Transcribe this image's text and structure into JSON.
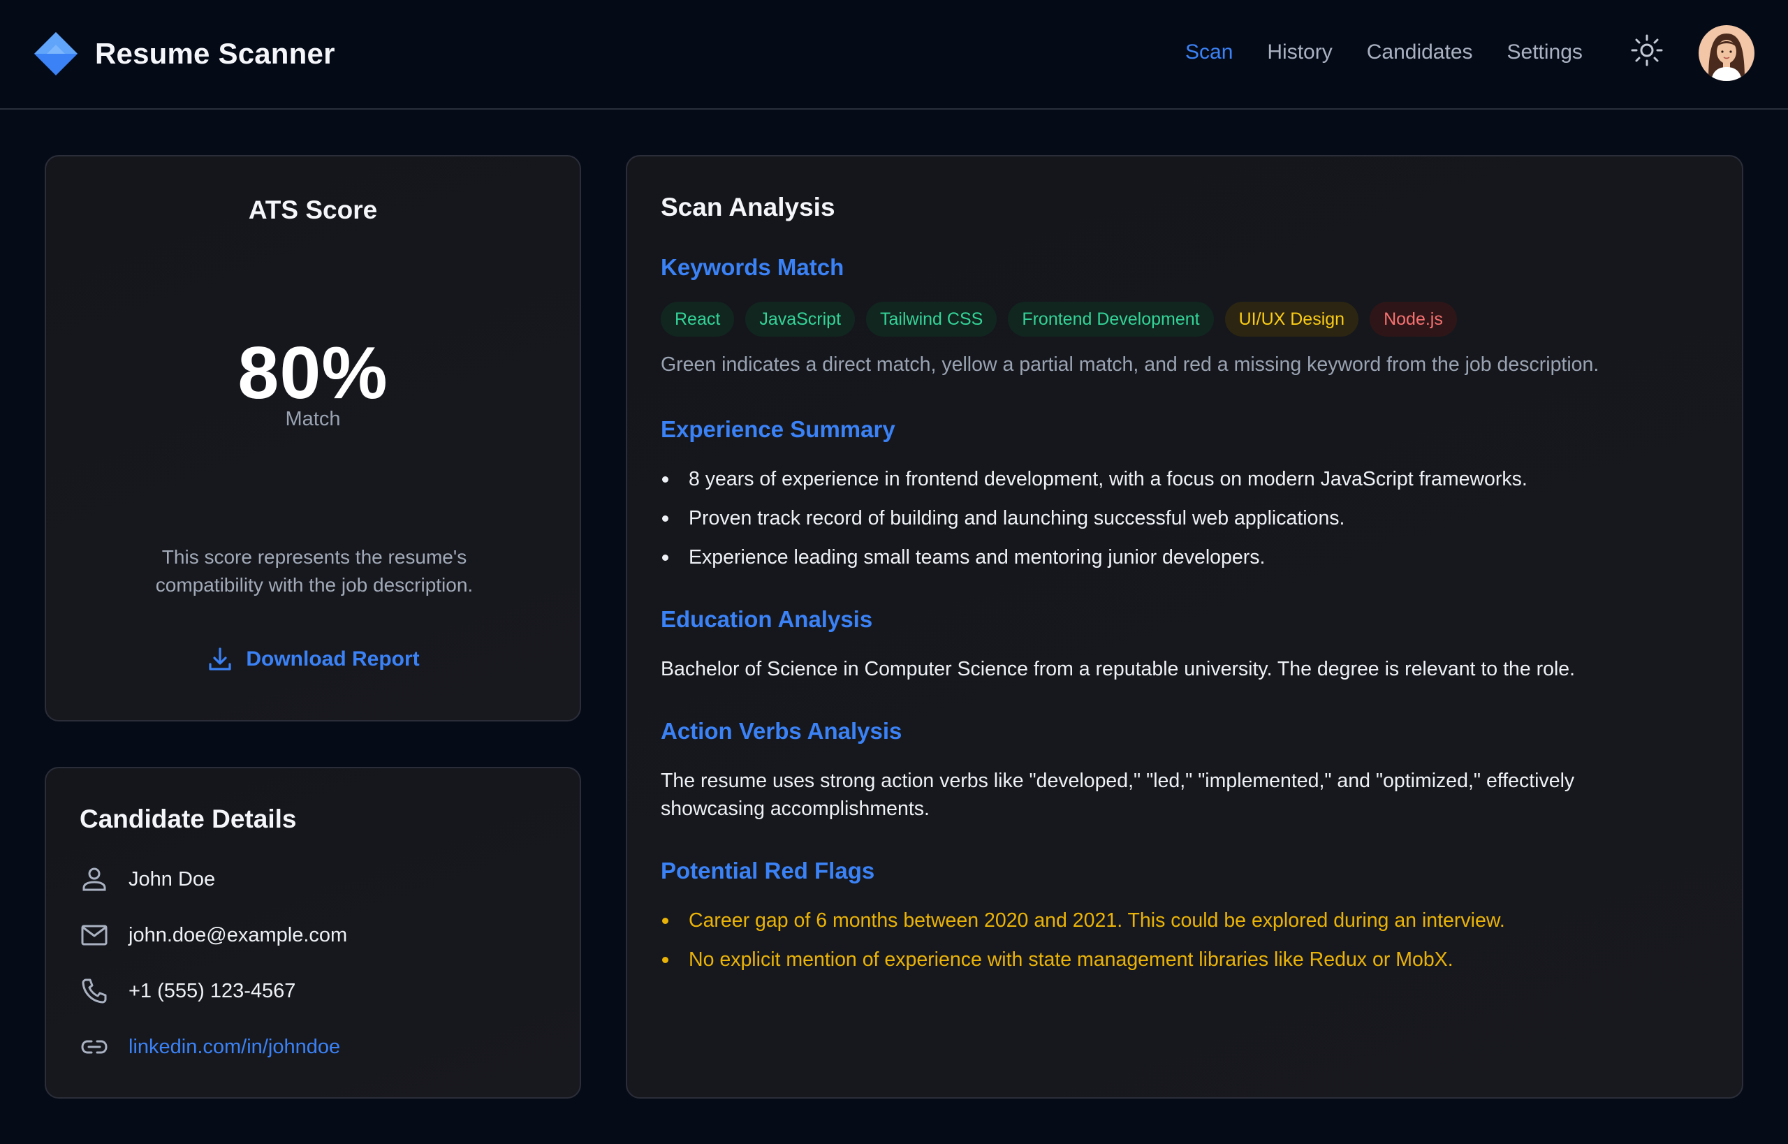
{
  "app": {
    "title": "Resume Scanner",
    "logo_icon": "diamond-logo-icon"
  },
  "nav": {
    "items": [
      {
        "label": "Scan",
        "active": true
      },
      {
        "label": "History",
        "active": false
      },
      {
        "label": "Candidates",
        "active": false
      },
      {
        "label": "Settings",
        "active": false
      }
    ],
    "theme_icon": "sun-icon",
    "avatar_icon": "user-avatar"
  },
  "score": {
    "title": "ATS Score",
    "value": "80%",
    "subtitle": "Match",
    "description": "This score represents the resume's compatibility with the job description.",
    "download_label": "Download Report",
    "download_icon": "download-icon"
  },
  "candidate": {
    "title": "Candidate Details",
    "name": "John Doe",
    "email": "john.doe@example.com",
    "phone": "+1 (555) 123-4567",
    "linkedin": "linkedin.com/in/johndoe"
  },
  "analysis": {
    "title": "Scan Analysis",
    "keywords": {
      "heading": "Keywords Match",
      "tags": [
        {
          "label": "React",
          "status": "match"
        },
        {
          "label": "JavaScript",
          "status": "match"
        },
        {
          "label": "Tailwind CSS",
          "status": "match"
        },
        {
          "label": "Frontend Development",
          "status": "match"
        },
        {
          "label": "UI/UX Design",
          "status": "partial"
        },
        {
          "label": "Node.js",
          "status": "missing"
        }
      ],
      "note": "Green indicates a direct match, yellow a partial match, and red a missing keyword from the job description."
    },
    "experience": {
      "heading": "Experience Summary",
      "items": [
        "8 years of experience in frontend development, with a focus on modern JavaScript frameworks.",
        "Proven track record of building and launching successful web applications.",
        "Experience leading small teams and mentoring junior developers."
      ]
    },
    "education": {
      "heading": "Education Analysis",
      "text": "Bachelor of Science in Computer Science from a reputable university. The degree is relevant to the role."
    },
    "action_verbs": {
      "heading": "Action Verbs Analysis",
      "text": "The resume uses strong action verbs like \"developed,\" \"led,\" \"implemented,\" and \"optimized,\" effectively showcasing accomplishments."
    },
    "red_flags": {
      "heading": "Potential Red Flags",
      "items": [
        "Career gap of 6 months between 2020 and 2021. This could be explored during an interview.",
        "No explicit mention of experience with state management libraries like Redux or MobX."
      ]
    }
  },
  "colors": {
    "accent": "#3b82f6",
    "match": "#34d399",
    "partial": "#facc15",
    "missing": "#f87171",
    "background": "#060b18"
  }
}
